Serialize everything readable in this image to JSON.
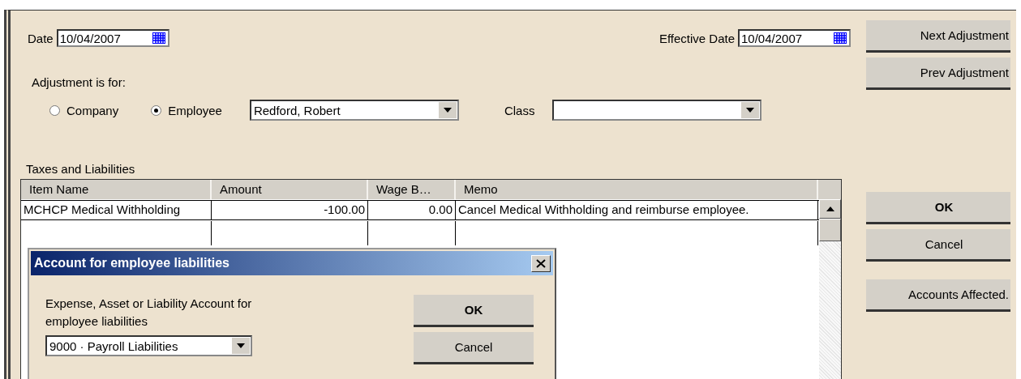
{
  "date": {
    "label": "Date",
    "value": "10/04/2007"
  },
  "effective_date": {
    "label": "Effective Date",
    "value": "10/04/2007"
  },
  "adjustment_for": {
    "label": "Adjustment is for:",
    "options": [
      {
        "label": "Company",
        "selected": false
      },
      {
        "label": "Employee",
        "selected": true
      }
    ],
    "employee": "Redford, Robert"
  },
  "class": {
    "label": "Class"
  },
  "taxes": {
    "title": "Taxes and Liabilities",
    "columns": [
      "Item Name",
      "Amount",
      "Wage B…",
      "Memo"
    ],
    "rows": [
      [
        "MCHCP Medical Withholding",
        "-100.00",
        "0.00",
        "Cancel Medical Withholding and reimburse employee."
      ]
    ]
  },
  "side_buttons": [
    [
      {
        "label": "Next Adjustment",
        "default": false
      },
      {
        "label": "Prev Adjustment",
        "default": false
      }
    ],
    [
      {
        "label": "OK",
        "default": true
      },
      {
        "label": "Cancel",
        "default": false
      }
    ],
    [
      {
        "label": "Accounts Affected.",
        "default": false
      }
    ]
  ],
  "dialog": {
    "title": "Account for employee liabilities",
    "label": "Expense, Asset or Liability Account for employee liabilities",
    "account": "9000 · Payroll Liabilities",
    "buttons": [
      {
        "label": "OK",
        "default": true
      },
      {
        "label": "Cancel",
        "default": false
      }
    ]
  }
}
